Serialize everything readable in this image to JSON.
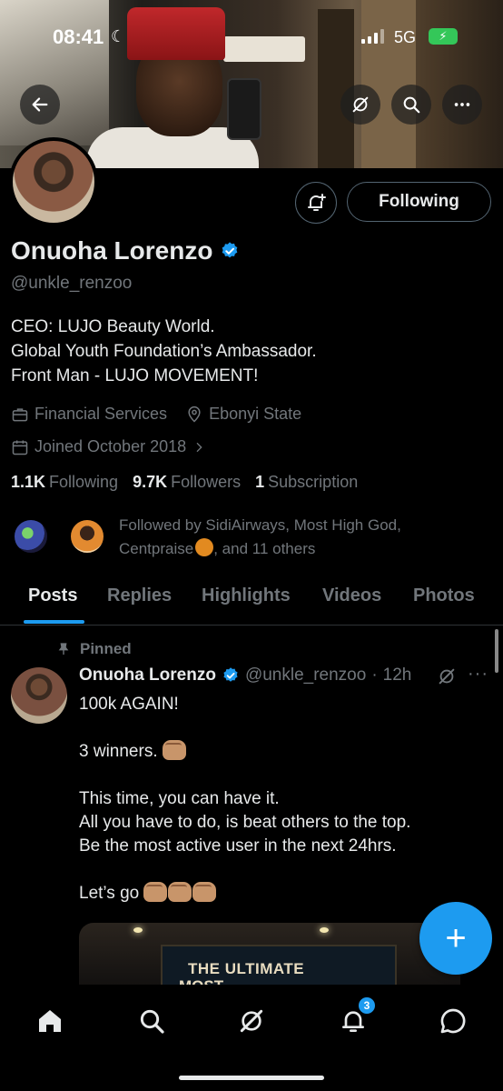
{
  "status_bar": {
    "time": "08:41",
    "network": "5G"
  },
  "profile": {
    "name": "Onuoha Lorenzo",
    "handle": "@unkle_renzoo",
    "following_button": "Following",
    "bio_lines": [
      "CEO: LUJO Beauty World.",
      "Global Youth Foundation’s Ambassador.",
      "Front Man - LUJO MOVEMENT!"
    ],
    "category": "Financial Services",
    "location": "Ebonyi State",
    "joined": "Joined October 2018",
    "following_count": "1.1K",
    "following_label": "Following",
    "followers_count": "9.7K",
    "followers_label": "Followers",
    "subscription_count": "1",
    "subscription_label": "Subscription",
    "followed_by_line1": "Followed by SidiAirways, Most High God,",
    "followed_by_name3": "Centpraise",
    "followed_by_tail": ", and 11 others"
  },
  "tabs": [
    "Posts",
    "Replies",
    "Highlights",
    "Videos",
    "Photos"
  ],
  "active_tab": "Posts",
  "post": {
    "pinned_label": "Pinned",
    "author": "Onuoha Lorenzo",
    "handle": "@unkle_renzoo",
    "separator": "·",
    "time": "12h",
    "more": "···",
    "line1": "100k AGAIN!",
    "line2": "3 winners.",
    "line3": "This time, you can have it.",
    "line4": "All you have to do, is beat others to the top.",
    "line5": "Be the most active user in the next 24hrs.",
    "line6": "Let’s go",
    "media_text_1": "THE ULTIMATE",
    "media_text_2": "MOST"
  },
  "bottom_nav": {
    "notifications_badge": "3"
  },
  "colors": {
    "accent": "#1d9bf0",
    "text_primary": "#e7e9ea",
    "text_secondary": "#71767b",
    "background": "#000000"
  }
}
